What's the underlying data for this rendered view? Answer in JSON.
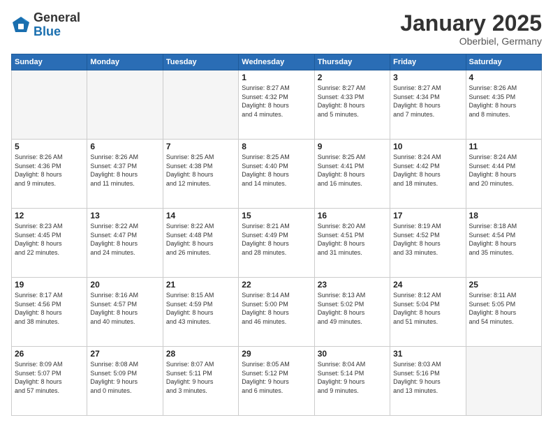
{
  "header": {
    "logo_general": "General",
    "logo_blue": "Blue",
    "month_title": "January 2025",
    "location": "Oberbiel, Germany"
  },
  "days_of_week": [
    "Sunday",
    "Monday",
    "Tuesday",
    "Wednesday",
    "Thursday",
    "Friday",
    "Saturday"
  ],
  "weeks": [
    [
      {
        "day": "",
        "info": ""
      },
      {
        "day": "",
        "info": ""
      },
      {
        "day": "",
        "info": ""
      },
      {
        "day": "1",
        "info": "Sunrise: 8:27 AM\nSunset: 4:32 PM\nDaylight: 8 hours\nand 4 minutes."
      },
      {
        "day": "2",
        "info": "Sunrise: 8:27 AM\nSunset: 4:33 PM\nDaylight: 8 hours\nand 5 minutes."
      },
      {
        "day": "3",
        "info": "Sunrise: 8:27 AM\nSunset: 4:34 PM\nDaylight: 8 hours\nand 7 minutes."
      },
      {
        "day": "4",
        "info": "Sunrise: 8:26 AM\nSunset: 4:35 PM\nDaylight: 8 hours\nand 8 minutes."
      }
    ],
    [
      {
        "day": "5",
        "info": "Sunrise: 8:26 AM\nSunset: 4:36 PM\nDaylight: 8 hours\nand 9 minutes."
      },
      {
        "day": "6",
        "info": "Sunrise: 8:26 AM\nSunset: 4:37 PM\nDaylight: 8 hours\nand 11 minutes."
      },
      {
        "day": "7",
        "info": "Sunrise: 8:25 AM\nSunset: 4:38 PM\nDaylight: 8 hours\nand 12 minutes."
      },
      {
        "day": "8",
        "info": "Sunrise: 8:25 AM\nSunset: 4:40 PM\nDaylight: 8 hours\nand 14 minutes."
      },
      {
        "day": "9",
        "info": "Sunrise: 8:25 AM\nSunset: 4:41 PM\nDaylight: 8 hours\nand 16 minutes."
      },
      {
        "day": "10",
        "info": "Sunrise: 8:24 AM\nSunset: 4:42 PM\nDaylight: 8 hours\nand 18 minutes."
      },
      {
        "day": "11",
        "info": "Sunrise: 8:24 AM\nSunset: 4:44 PM\nDaylight: 8 hours\nand 20 minutes."
      }
    ],
    [
      {
        "day": "12",
        "info": "Sunrise: 8:23 AM\nSunset: 4:45 PM\nDaylight: 8 hours\nand 22 minutes."
      },
      {
        "day": "13",
        "info": "Sunrise: 8:22 AM\nSunset: 4:47 PM\nDaylight: 8 hours\nand 24 minutes."
      },
      {
        "day": "14",
        "info": "Sunrise: 8:22 AM\nSunset: 4:48 PM\nDaylight: 8 hours\nand 26 minutes."
      },
      {
        "day": "15",
        "info": "Sunrise: 8:21 AM\nSunset: 4:49 PM\nDaylight: 8 hours\nand 28 minutes."
      },
      {
        "day": "16",
        "info": "Sunrise: 8:20 AM\nSunset: 4:51 PM\nDaylight: 8 hours\nand 31 minutes."
      },
      {
        "day": "17",
        "info": "Sunrise: 8:19 AM\nSunset: 4:52 PM\nDaylight: 8 hours\nand 33 minutes."
      },
      {
        "day": "18",
        "info": "Sunrise: 8:18 AM\nSunset: 4:54 PM\nDaylight: 8 hours\nand 35 minutes."
      }
    ],
    [
      {
        "day": "19",
        "info": "Sunrise: 8:17 AM\nSunset: 4:56 PM\nDaylight: 8 hours\nand 38 minutes."
      },
      {
        "day": "20",
        "info": "Sunrise: 8:16 AM\nSunset: 4:57 PM\nDaylight: 8 hours\nand 40 minutes."
      },
      {
        "day": "21",
        "info": "Sunrise: 8:15 AM\nSunset: 4:59 PM\nDaylight: 8 hours\nand 43 minutes."
      },
      {
        "day": "22",
        "info": "Sunrise: 8:14 AM\nSunset: 5:00 PM\nDaylight: 8 hours\nand 46 minutes."
      },
      {
        "day": "23",
        "info": "Sunrise: 8:13 AM\nSunset: 5:02 PM\nDaylight: 8 hours\nand 49 minutes."
      },
      {
        "day": "24",
        "info": "Sunrise: 8:12 AM\nSunset: 5:04 PM\nDaylight: 8 hours\nand 51 minutes."
      },
      {
        "day": "25",
        "info": "Sunrise: 8:11 AM\nSunset: 5:05 PM\nDaylight: 8 hours\nand 54 minutes."
      }
    ],
    [
      {
        "day": "26",
        "info": "Sunrise: 8:09 AM\nSunset: 5:07 PM\nDaylight: 8 hours\nand 57 minutes."
      },
      {
        "day": "27",
        "info": "Sunrise: 8:08 AM\nSunset: 5:09 PM\nDaylight: 9 hours\nand 0 minutes."
      },
      {
        "day": "28",
        "info": "Sunrise: 8:07 AM\nSunset: 5:11 PM\nDaylight: 9 hours\nand 3 minutes."
      },
      {
        "day": "29",
        "info": "Sunrise: 8:05 AM\nSunset: 5:12 PM\nDaylight: 9 hours\nand 6 minutes."
      },
      {
        "day": "30",
        "info": "Sunrise: 8:04 AM\nSunset: 5:14 PM\nDaylight: 9 hours\nand 9 minutes."
      },
      {
        "day": "31",
        "info": "Sunrise: 8:03 AM\nSunset: 5:16 PM\nDaylight: 9 hours\nand 13 minutes."
      },
      {
        "day": "",
        "info": ""
      }
    ]
  ]
}
